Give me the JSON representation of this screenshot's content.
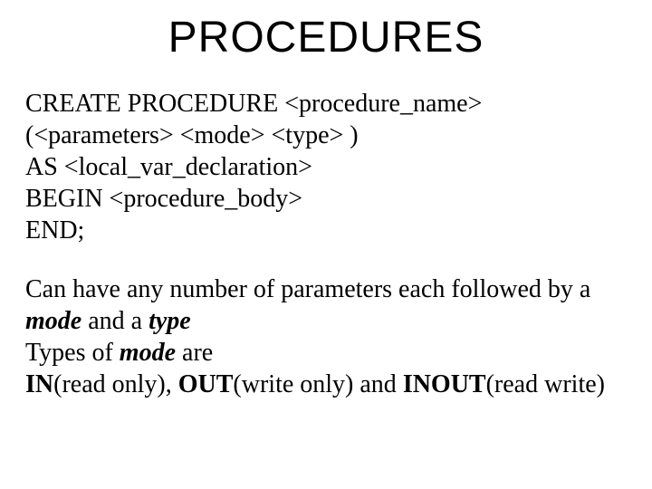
{
  "title": "PROCEDURES",
  "code": {
    "l1": "CREATE PROCEDURE <procedure_name>",
    "l2": "(<parameters>  <mode>  <type> )",
    "l3": "AS <local_var_declaration>",
    "l4": "BEGIN <procedure_body>",
    "l5": "END;"
  },
  "desc": {
    "p1a": "Can have any number of parameters each followed by a ",
    "mode": "mode",
    "p1b": "  and a ",
    "type": "type",
    "p2a": "Types of ",
    "p2b": " are ",
    "in": "IN",
    "in_txt": "(read only), ",
    "out": "OUT",
    "out_txt": "(write only) and ",
    "inout": "INOUT",
    "inout_txt": "(read write)"
  }
}
